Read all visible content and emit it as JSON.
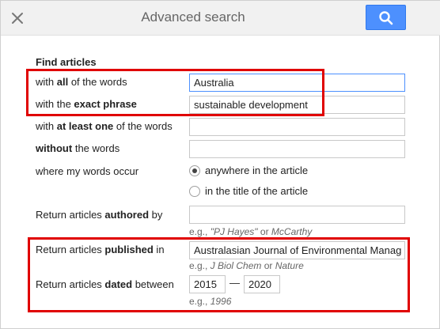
{
  "header": {
    "title": "Advanced search",
    "close_icon": "close-icon",
    "search_icon": "search-icon",
    "accent_color": "#4d90fe"
  },
  "form": {
    "section_title": "Find articles",
    "all_words": {
      "pre": "with ",
      "bold": "all",
      "post": " of the words",
      "value": "Australia"
    },
    "exact_phrase": {
      "pre": "with the ",
      "bold": "exact phrase",
      "post": "",
      "value": "sustainable development"
    },
    "at_least_one": {
      "pre": "with ",
      "bold": "at least one",
      "post": " of the words",
      "value": ""
    },
    "without": {
      "pre": "",
      "bold": "without",
      "post": " the words",
      "value": ""
    },
    "where_occur": {
      "label": "where my words occur",
      "options": [
        "anywhere in the article",
        "in the title of the article"
      ],
      "selected": "anywhere in the article"
    },
    "authored": {
      "pre": "Return articles ",
      "bold": "authored",
      "post": " by",
      "value": "",
      "hint_pre": "e.g., ",
      "hint_ex1": "\"PJ Hayes\"",
      "hint_mid": " or ",
      "hint_ex2": "McCarthy"
    },
    "published": {
      "pre": "Return articles ",
      "bold": "published",
      "post": " in",
      "value": "Australasian Journal of Environmental Manag",
      "hint_pre": "e.g., ",
      "hint_ex1": "J Biol Chem",
      "hint_mid": " or ",
      "hint_ex2": "Nature"
    },
    "dated": {
      "pre": "Return articles ",
      "bold": "dated",
      "post": " between",
      "from": "2015",
      "separator": "—",
      "to": "2020",
      "hint_pre": "e.g., ",
      "hint_ex1": "1996"
    }
  },
  "annotation_color": "#e00000"
}
